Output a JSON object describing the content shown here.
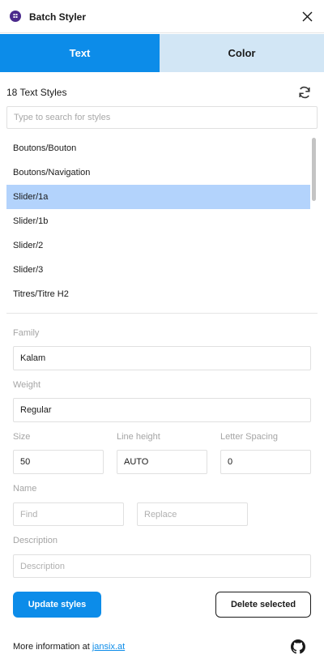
{
  "header": {
    "title": "Batch Styler",
    "plugin_icon": "batch-styler-logo-icon",
    "close_icon": "close-icon"
  },
  "tabs": [
    {
      "label": "Text",
      "active": true
    },
    {
      "label": "Color",
      "active": false
    }
  ],
  "styles_panel": {
    "count_label": "18 Text Styles",
    "refresh_icon": "refresh-icon",
    "search_placeholder": "Type to search for styles",
    "items": [
      {
        "label": "Boutons/Bouton",
        "selected": false
      },
      {
        "label": "Boutons/Navigation",
        "selected": false
      },
      {
        "label": "Slider/1a",
        "selected": true
      },
      {
        "label": "Slider/1b",
        "selected": false
      },
      {
        "label": "Slider/2",
        "selected": false
      },
      {
        "label": "Slider/3",
        "selected": false
      },
      {
        "label": "Titres/Titre H2",
        "selected": false
      }
    ]
  },
  "form": {
    "family_label": "Family",
    "family_value": "Kalam",
    "weight_label": "Weight",
    "weight_value": "Regular",
    "size_label": "Size",
    "size_value": "50",
    "line_height_label": "Line height",
    "line_height_value": "AUTO",
    "letter_spacing_label": "Letter Spacing",
    "letter_spacing_value": "0",
    "name_label": "Name",
    "find_placeholder": "Find",
    "replace_placeholder": "Replace",
    "description_label": "Description",
    "description_placeholder": "Description"
  },
  "actions": {
    "update_label": "Update styles",
    "delete_label": "Delete selected"
  },
  "footer": {
    "text": "More information at ",
    "link_text": "jansix.at",
    "github_icon": "github-icon"
  },
  "colors": {
    "accent": "#0c8ce9",
    "tab_inactive": "#d2e6f5",
    "selection": "#b3d3fc"
  }
}
